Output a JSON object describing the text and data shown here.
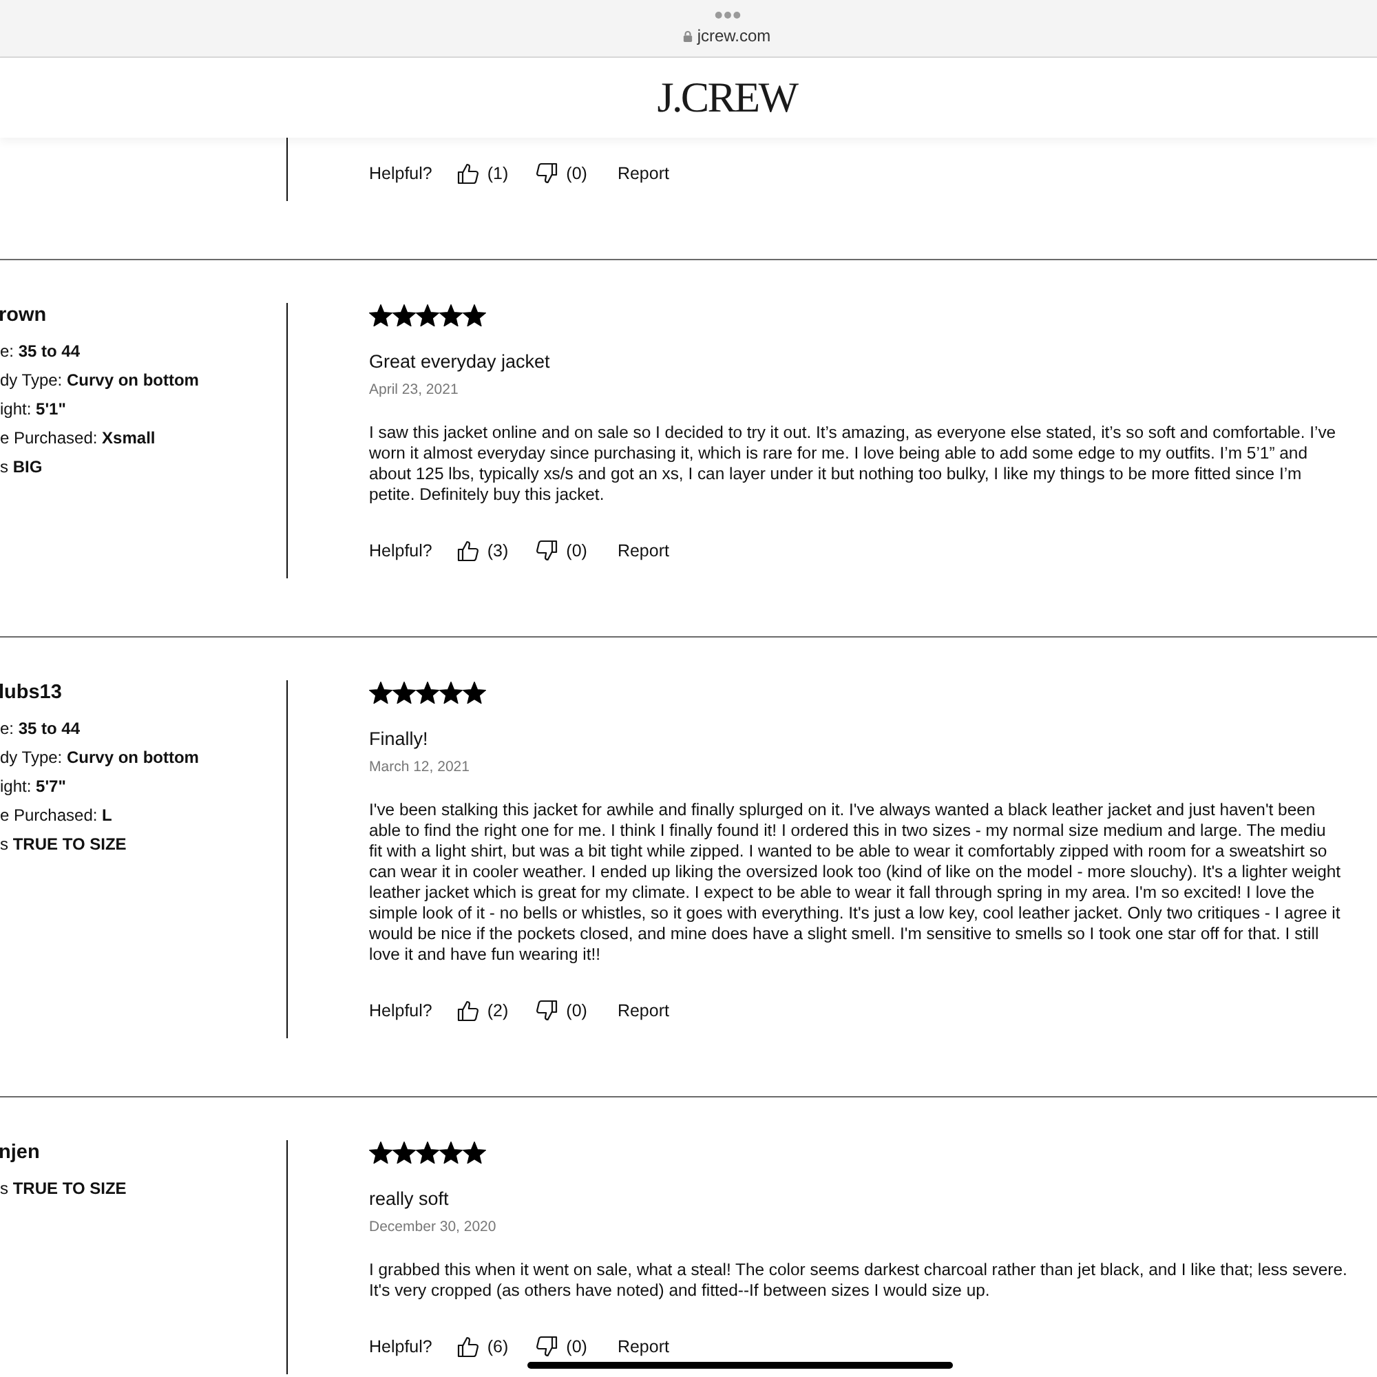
{
  "browser_bar": {
    "url": "jcrew.com"
  },
  "site_header": {
    "logo": "J.CREW"
  },
  "reviews": [
    {
      "helpful": {
        "label": "Helpful?",
        "yes_count": "(1)",
        "no_count": "(0)",
        "report": "Report"
      }
    },
    {
      "reviewer": "rown",
      "attributes": [
        "e: **35 to 44**",
        "dy Type: **Curvy on bottom**",
        "ight: **5'1\"**",
        "e Purchased: **Xsmall**",
        "s **BIG**"
      ],
      "stars": 5,
      "title": "Great everyday jacket",
      "date": "April 23, 2021",
      "body": "I saw this jacket online and on sale so I decided to try it out. It’s amazing, as everyone else stated, it’s so soft and comfortable. I’ve\nworn it almost everyday since purchasing it, which is rare for me. I love being able to add some edge to my outfits. I’m 5’1” and\nabout 125 lbs, typically xs/s and got an xs, I can layer under it but nothing too bulky, I like my things to be more fitted since I’m\npetite. Definitely buy this jacket.",
      "helpful": {
        "label": "Helpful?",
        "yes_count": "(3)",
        "no_count": "(0)",
        "report": "Report"
      }
    },
    {
      "reviewer": "lubs13",
      "attributes": [
        "e: **35 to 44**",
        "dy Type: **Curvy on bottom**",
        "ight: **5'7\"**",
        "e Purchased: **L**",
        "s **TRUE TO SIZE**"
      ],
      "stars": 5,
      "title": "Finally!",
      "date": "March 12, 2021",
      "body": "I've been stalking this jacket for awhile and finally splurged on it. I've always wanted a black leather jacket and just haven't been\nable to find the right one for me. I think I finally found it! I ordered this in two sizes - my normal size medium and large. The mediu\nfit with a light shirt, but was a bit tight while zipped. I wanted to be able to wear it comfortably zipped with room for a sweatshirt so\ncan wear it in cooler weather. I ended up liking the oversized look too (kind of like on the model - more slouchy). It's a lighter weight\nleather jacket which is great for my climate. I expect to be able to wear it fall through spring in my area. I'm so excited! I love the\nsimple look of it - no bells or whistles, so it goes with everything. It's just a low key, cool leather jacket. Only two critiques - I agree it\nwould be nice if the pockets closed, and mine does have a slight smell. I'm sensitive to smells so I took one star off for that. I still\nlove it and have fun wearing it!!",
      "helpful": {
        "label": "Helpful?",
        "yes_count": "(2)",
        "no_count": "(0)",
        "report": "Report"
      }
    },
    {
      "reviewer": "njen",
      "attributes": [
        "s **TRUE TO SIZE**"
      ],
      "stars": 5,
      "title": "really soft",
      "date": "December 30, 2020",
      "body": "I grabbed this when it went on sale, what a steal! The color seems darkest charcoal rather than jet black, and I like that; less severe.\nIt's very cropped (as others have noted) and fitted--If between sizes I would size up.",
      "helpful": {
        "label": "Helpful?",
        "yes_count": "(6)",
        "no_count": "(0)",
        "report": "Report"
      }
    }
  ]
}
